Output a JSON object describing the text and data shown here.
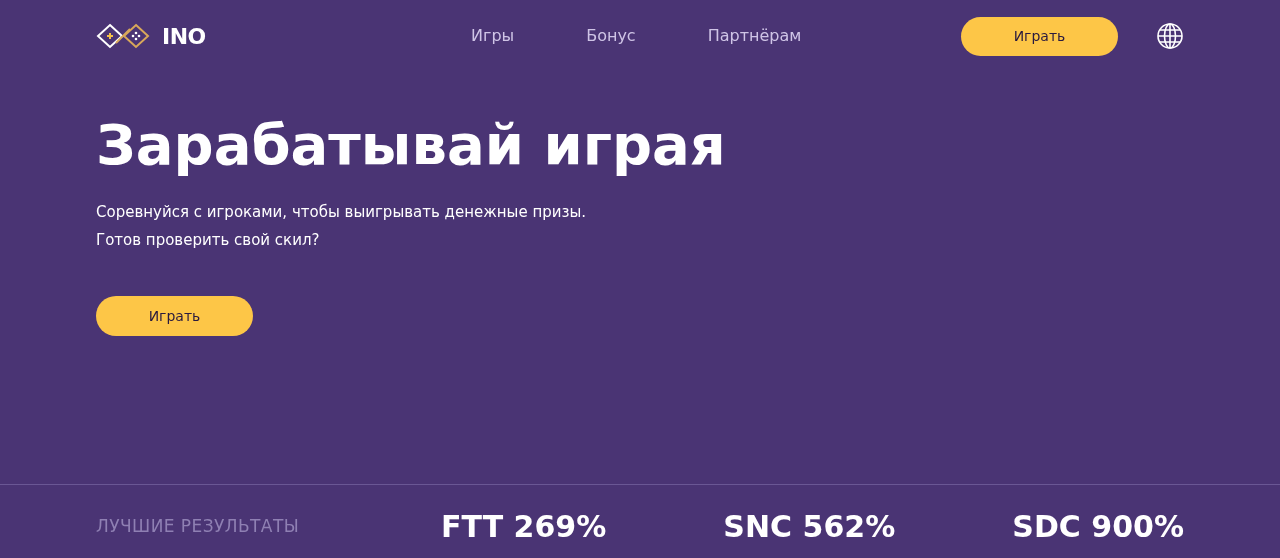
{
  "header": {
    "logo": "INO",
    "nav": [
      "Игры",
      "Бонус",
      "Партнёрам"
    ],
    "cta": "Играть"
  },
  "hero": {
    "title": "Зарабатывай играя",
    "lines": [
      "Соревнуйся с игроками, чтобы выигрывать денежные призы.",
      "Готов проверить свой скил?"
    ],
    "button": "Играть"
  },
  "results": {
    "label": "ЛУЧШИЕ РЕЗУЛЬТАТЫ",
    "items": [
      "FTT 269%",
      "SNC 562%",
      "SDC 900%"
    ]
  }
}
